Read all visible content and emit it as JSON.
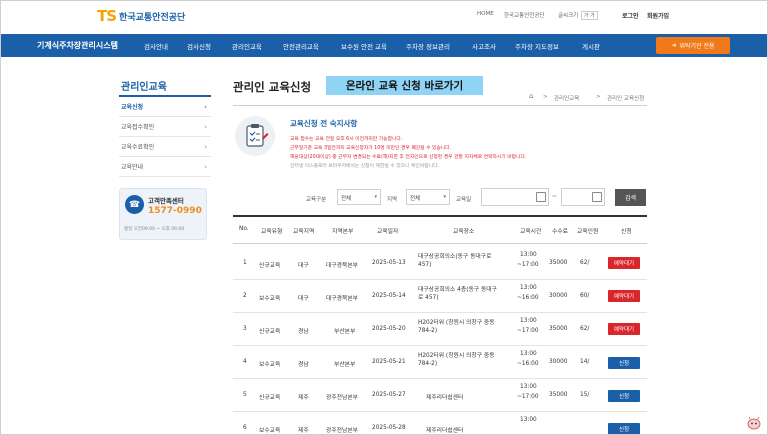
{
  "header": {
    "logo_mark": "TS",
    "logo_text": "한국교통안전공단",
    "util_links": [
      "HOME",
      "한국교통안전공단",
      "글씨크기"
    ],
    "login": "로그인",
    "join": "회원가입"
  },
  "nav": {
    "brand": "기계식주차장관리시스템",
    "items": [
      "검사안내",
      "검사신청",
      "관리인교육",
      "안전관리교육",
      "보수원 안전 교육",
      "주차장 정보관리",
      "사고조사",
      "주차장 지도정보",
      "게시판"
    ],
    "cta": "위탁기관 전용"
  },
  "sidebar": {
    "title": "관리인교육",
    "items": [
      {
        "label": "교육신청",
        "active": true
      },
      {
        "label": "교육접수확인",
        "active": false
      },
      {
        "label": "교육수료확인",
        "active": false
      },
      {
        "label": "교육안내",
        "active": false
      }
    ],
    "support": {
      "title": "고객만족센터",
      "phone": "1577-0990",
      "hours": "평일 오전09:00 ~ 오후 06:00"
    }
  },
  "page": {
    "title": "관리인 교육신청",
    "online_button": "온라인 교육 신청 바로가기",
    "breadcrumb": [
      "관리인교육",
      "관리인 교육신청"
    ]
  },
  "notice": {
    "title": "교육신청 전 숙지사항",
    "lines": [
      "교육 접수는 교육 전일 오후 6시 이전까지만 가능합니다.",
      "근무일기준 교육 3일전까지 교육신청자가 10명 미만인 경우 폐강될 수 있습니다.",
      "해당대상(20대이상) 중 근무지 변경되는 수료(해)지한 후 전자인으로 신청된 경우 관할 지자체로 연락하시기 바랍니다.",
      "인터넷 이스플로러 브라우저에서는 신청이 제한될 수 있으니 확인바랍니다."
    ]
  },
  "filter": {
    "type_label": "교육구분",
    "type_value": "전체",
    "region_label": "지역",
    "region_value": "전체",
    "date_label": "교육일",
    "date_sep": "~",
    "search": "검색"
  },
  "table": {
    "headers": [
      "No.",
      "교육유형",
      "교육지역",
      "지역본부",
      "교육일자",
      "교육장소",
      "교육시간",
      "수수료",
      "교육인원",
      "신청"
    ],
    "rows": [
      {
        "no": "1",
        "type": "신규교육",
        "region": "대구",
        "branch": "대구경북본부",
        "date": "2025-05-13",
        "place": "대구상공회의소(동구 동대구로 457)",
        "time_start": "13:00",
        "time_end": "~17:00",
        "fee": "35000",
        "seats": "62/",
        "action": "예약대기",
        "action_style": "red"
      },
      {
        "no": "2",
        "type": "보수교육",
        "region": "대구",
        "branch": "대구경북본부",
        "date": "2025-05-14",
        "place": "대구상공회의소 4층(동구 동대구로 457)",
        "time_start": "13:00",
        "time_end": "~16:00",
        "fee": "30000",
        "seats": "60/",
        "action": "예약대기",
        "action_style": "red"
      },
      {
        "no": "3",
        "type": "신규교육",
        "region": "경남",
        "branch": "부산본부",
        "date": "2025-05-20",
        "place": "H202타워 (창원시 의창구 중동 784-2)",
        "time_start": "13:00",
        "time_end": "~17:00",
        "fee": "35000",
        "seats": "62/",
        "action": "예약대기",
        "action_style": "red"
      },
      {
        "no": "4",
        "type": "보수교육",
        "region": "경남",
        "branch": "부산본부",
        "date": "2025-05-21",
        "place": "H202타워 (창원시 의창구 중동 784-2)",
        "time_start": "13:00",
        "time_end": "~16:00",
        "fee": "30000",
        "seats": "14/",
        "action": "신청",
        "action_style": "blue"
      },
      {
        "no": "5",
        "type": "신규교육",
        "region": "제주",
        "branch": "광주전남본부",
        "date": "2025-05-27",
        "place": "제주리더쉽센터",
        "time_start": "13:00",
        "time_end": "~17:00",
        "fee": "35000",
        "seats": "15/",
        "action": "신청",
        "action_style": "blue"
      },
      {
        "no": "6",
        "type": "보수교육",
        "region": "제주",
        "branch": "광주전남본부",
        "date": "2025-05-28",
        "place": "제주리더쉽센터",
        "time_start": "13:00",
        "time_end": "",
        "fee": "",
        "seats": "",
        "action": "신청",
        "action_style": "blue"
      }
    ]
  }
}
